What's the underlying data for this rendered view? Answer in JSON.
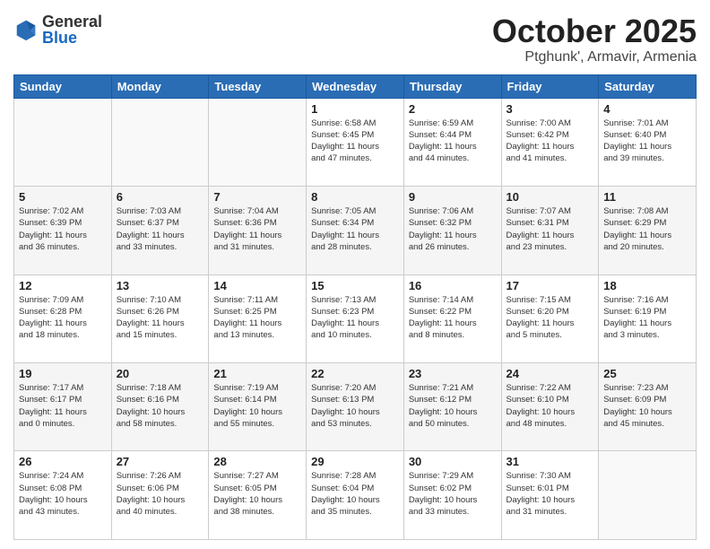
{
  "header": {
    "logo": {
      "general": "General",
      "blue": "Blue"
    },
    "title": "October 2025",
    "location": "Ptghunk', Armavir, Armenia"
  },
  "days_of_week": [
    "Sunday",
    "Monday",
    "Tuesday",
    "Wednesday",
    "Thursday",
    "Friday",
    "Saturday"
  ],
  "weeks": [
    [
      {
        "day": "",
        "info": ""
      },
      {
        "day": "",
        "info": ""
      },
      {
        "day": "",
        "info": ""
      },
      {
        "day": "1",
        "info": "Sunrise: 6:58 AM\nSunset: 6:45 PM\nDaylight: 11 hours\nand 47 minutes."
      },
      {
        "day": "2",
        "info": "Sunrise: 6:59 AM\nSunset: 6:44 PM\nDaylight: 11 hours\nand 44 minutes."
      },
      {
        "day": "3",
        "info": "Sunrise: 7:00 AM\nSunset: 6:42 PM\nDaylight: 11 hours\nand 41 minutes."
      },
      {
        "day": "4",
        "info": "Sunrise: 7:01 AM\nSunset: 6:40 PM\nDaylight: 11 hours\nand 39 minutes."
      }
    ],
    [
      {
        "day": "5",
        "info": "Sunrise: 7:02 AM\nSunset: 6:39 PM\nDaylight: 11 hours\nand 36 minutes."
      },
      {
        "day": "6",
        "info": "Sunrise: 7:03 AM\nSunset: 6:37 PM\nDaylight: 11 hours\nand 33 minutes."
      },
      {
        "day": "7",
        "info": "Sunrise: 7:04 AM\nSunset: 6:36 PM\nDaylight: 11 hours\nand 31 minutes."
      },
      {
        "day": "8",
        "info": "Sunrise: 7:05 AM\nSunset: 6:34 PM\nDaylight: 11 hours\nand 28 minutes."
      },
      {
        "day": "9",
        "info": "Sunrise: 7:06 AM\nSunset: 6:32 PM\nDaylight: 11 hours\nand 26 minutes."
      },
      {
        "day": "10",
        "info": "Sunrise: 7:07 AM\nSunset: 6:31 PM\nDaylight: 11 hours\nand 23 minutes."
      },
      {
        "day": "11",
        "info": "Sunrise: 7:08 AM\nSunset: 6:29 PM\nDaylight: 11 hours\nand 20 minutes."
      }
    ],
    [
      {
        "day": "12",
        "info": "Sunrise: 7:09 AM\nSunset: 6:28 PM\nDaylight: 11 hours\nand 18 minutes."
      },
      {
        "day": "13",
        "info": "Sunrise: 7:10 AM\nSunset: 6:26 PM\nDaylight: 11 hours\nand 15 minutes."
      },
      {
        "day": "14",
        "info": "Sunrise: 7:11 AM\nSunset: 6:25 PM\nDaylight: 11 hours\nand 13 minutes."
      },
      {
        "day": "15",
        "info": "Sunrise: 7:13 AM\nSunset: 6:23 PM\nDaylight: 11 hours\nand 10 minutes."
      },
      {
        "day": "16",
        "info": "Sunrise: 7:14 AM\nSunset: 6:22 PM\nDaylight: 11 hours\nand 8 minutes."
      },
      {
        "day": "17",
        "info": "Sunrise: 7:15 AM\nSunset: 6:20 PM\nDaylight: 11 hours\nand 5 minutes."
      },
      {
        "day": "18",
        "info": "Sunrise: 7:16 AM\nSunset: 6:19 PM\nDaylight: 11 hours\nand 3 minutes."
      }
    ],
    [
      {
        "day": "19",
        "info": "Sunrise: 7:17 AM\nSunset: 6:17 PM\nDaylight: 11 hours\nand 0 minutes."
      },
      {
        "day": "20",
        "info": "Sunrise: 7:18 AM\nSunset: 6:16 PM\nDaylight: 10 hours\nand 58 minutes."
      },
      {
        "day": "21",
        "info": "Sunrise: 7:19 AM\nSunset: 6:14 PM\nDaylight: 10 hours\nand 55 minutes."
      },
      {
        "day": "22",
        "info": "Sunrise: 7:20 AM\nSunset: 6:13 PM\nDaylight: 10 hours\nand 53 minutes."
      },
      {
        "day": "23",
        "info": "Sunrise: 7:21 AM\nSunset: 6:12 PM\nDaylight: 10 hours\nand 50 minutes."
      },
      {
        "day": "24",
        "info": "Sunrise: 7:22 AM\nSunset: 6:10 PM\nDaylight: 10 hours\nand 48 minutes."
      },
      {
        "day": "25",
        "info": "Sunrise: 7:23 AM\nSunset: 6:09 PM\nDaylight: 10 hours\nand 45 minutes."
      }
    ],
    [
      {
        "day": "26",
        "info": "Sunrise: 7:24 AM\nSunset: 6:08 PM\nDaylight: 10 hours\nand 43 minutes."
      },
      {
        "day": "27",
        "info": "Sunrise: 7:26 AM\nSunset: 6:06 PM\nDaylight: 10 hours\nand 40 minutes."
      },
      {
        "day": "28",
        "info": "Sunrise: 7:27 AM\nSunset: 6:05 PM\nDaylight: 10 hours\nand 38 minutes."
      },
      {
        "day": "29",
        "info": "Sunrise: 7:28 AM\nSunset: 6:04 PM\nDaylight: 10 hours\nand 35 minutes."
      },
      {
        "day": "30",
        "info": "Sunrise: 7:29 AM\nSunset: 6:02 PM\nDaylight: 10 hours\nand 33 minutes."
      },
      {
        "day": "31",
        "info": "Sunrise: 7:30 AM\nSunset: 6:01 PM\nDaylight: 10 hours\nand 31 minutes."
      },
      {
        "day": "",
        "info": ""
      }
    ]
  ]
}
